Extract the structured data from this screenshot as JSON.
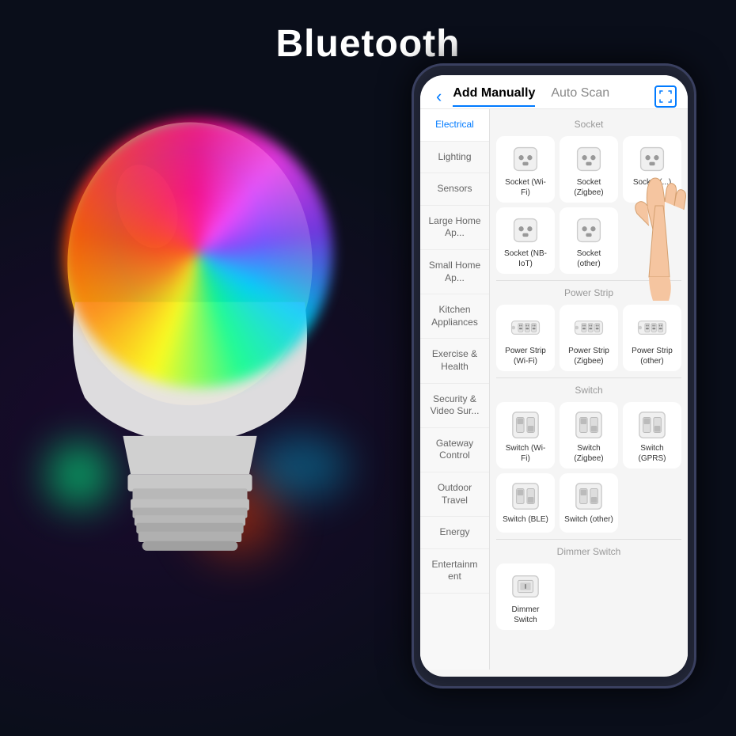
{
  "title": "Bluetooth",
  "header": {
    "back_label": "‹",
    "add_manually_tab": "Add Manually",
    "auto_scan_tab": "Auto Scan"
  },
  "sidebar": {
    "items": [
      {
        "label": "Electrical",
        "active": true
      },
      {
        "label": "Lighting",
        "active": false
      },
      {
        "label": "Sensors",
        "active": false
      },
      {
        "label": "Large Home Ap...",
        "active": false
      },
      {
        "label": "Small Home Ap...",
        "active": false
      },
      {
        "label": "Kitchen Appliances",
        "active": false
      },
      {
        "label": "Exercise & Health",
        "active": false
      },
      {
        "label": "Security & Video Sur...",
        "active": false
      },
      {
        "label": "Gateway Control",
        "active": false
      },
      {
        "label": "Outdoor Travel",
        "active": false
      },
      {
        "label": "Energy",
        "active": false
      },
      {
        "label": "Entertainm ent",
        "active": false
      }
    ]
  },
  "content": {
    "sections": [
      {
        "title": "Socket",
        "devices": [
          {
            "label": "Socket\n(Wi-Fi)",
            "type": "socket"
          },
          {
            "label": "Socket\n(Zigbee)",
            "type": "socket"
          },
          {
            "label": "Socket\n(...)",
            "type": "socket"
          },
          {
            "label": "Socket\n(NB-IoT)",
            "type": "socket"
          },
          {
            "label": "Socket\n(other)",
            "type": "socket"
          }
        ]
      },
      {
        "title": "Power Strip",
        "devices": [
          {
            "label": "Power Strip\n(Wi-Fi)",
            "type": "powerstrip"
          },
          {
            "label": "Power Strip\n(Zigbee)",
            "type": "powerstrip"
          },
          {
            "label": "Power Strip\n(other)",
            "type": "powerstrip"
          }
        ]
      },
      {
        "title": "Switch",
        "devices": [
          {
            "label": "Switch\n(Wi-Fi)",
            "type": "switch"
          },
          {
            "label": "Switch\n(Zigbee)",
            "type": "switch"
          },
          {
            "label": "Switch\n(GPRS)",
            "type": "switch"
          },
          {
            "label": "Switch\n(BLE)",
            "type": "switch"
          },
          {
            "label": "Switch\n(other)",
            "type": "switch"
          }
        ]
      },
      {
        "title": "Dimmer Switch",
        "devices": [
          {
            "label": "Dimmer\nSwitch",
            "type": "dimmer"
          }
        ]
      }
    ]
  }
}
